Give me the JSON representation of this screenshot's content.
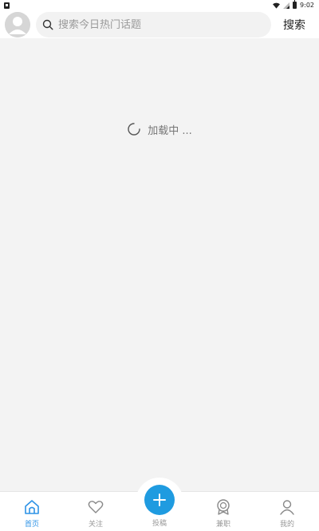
{
  "status_bar": {
    "time": "9:02",
    "icons": [
      "notification-icon",
      "wifi-icon",
      "signal-icon",
      "battery-icon"
    ]
  },
  "header": {
    "avatar": "avatar-placeholder-icon",
    "search_placeholder": "搜索今日热门话题",
    "search_value": "",
    "search_button_label": "搜索"
  },
  "main": {
    "loading_text": "加载中 ..."
  },
  "bottom_nav": {
    "items": [
      {
        "label": "首页",
        "icon": "home-icon",
        "active": true
      },
      {
        "label": "关注",
        "icon": "heart-icon",
        "active": false
      },
      {
        "label": "投稿",
        "icon": "plus-icon",
        "active": false
      },
      {
        "label": "兼职",
        "icon": "badge-icon",
        "active": false
      },
      {
        "label": "我的",
        "icon": "user-icon",
        "active": false
      }
    ]
  },
  "colors": {
    "accent": "#2e93e6",
    "publish_button": "#1f9be0",
    "background": "#f3f3f3"
  }
}
